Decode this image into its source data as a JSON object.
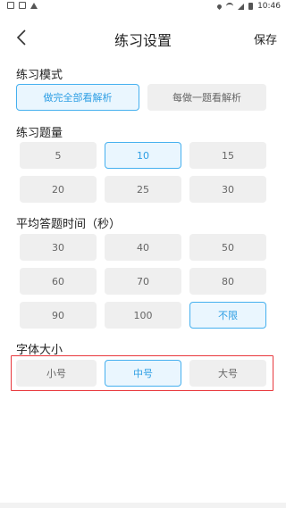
{
  "status_bar": {
    "time": "10:46",
    "left_icons": [
      "square-icon",
      "square-icon",
      "alert-icon"
    ],
    "right_icons": [
      "location-icon",
      "wifi-icon",
      "signal-icon",
      "battery-icon"
    ]
  },
  "header": {
    "title": "练习设置",
    "save_label": "保存",
    "back_icon": "chevron-left-icon"
  },
  "practice_mode": {
    "title": "练习模式",
    "options": [
      "做完全部看解析",
      "每做一题看解析"
    ],
    "selected_index": 0
  },
  "question_count": {
    "title": "练习题量",
    "options": [
      "5",
      "10",
      "15",
      "20",
      "25",
      "30"
    ],
    "selected_index": 1
  },
  "avg_time": {
    "title": "平均答题时间（秒）",
    "options": [
      "30",
      "40",
      "50",
      "60",
      "70",
      "80",
      "90",
      "100",
      "不限"
    ],
    "selected_index": 8
  },
  "font_size": {
    "title": "字体大小",
    "options": [
      "小号",
      "中号",
      "大号"
    ],
    "selected_index": 1,
    "highlight_color": "#e8383d"
  },
  "colors": {
    "accent": "#45b0ef",
    "accent_text": "#2f9fe4",
    "button_bg": "#efefef"
  }
}
